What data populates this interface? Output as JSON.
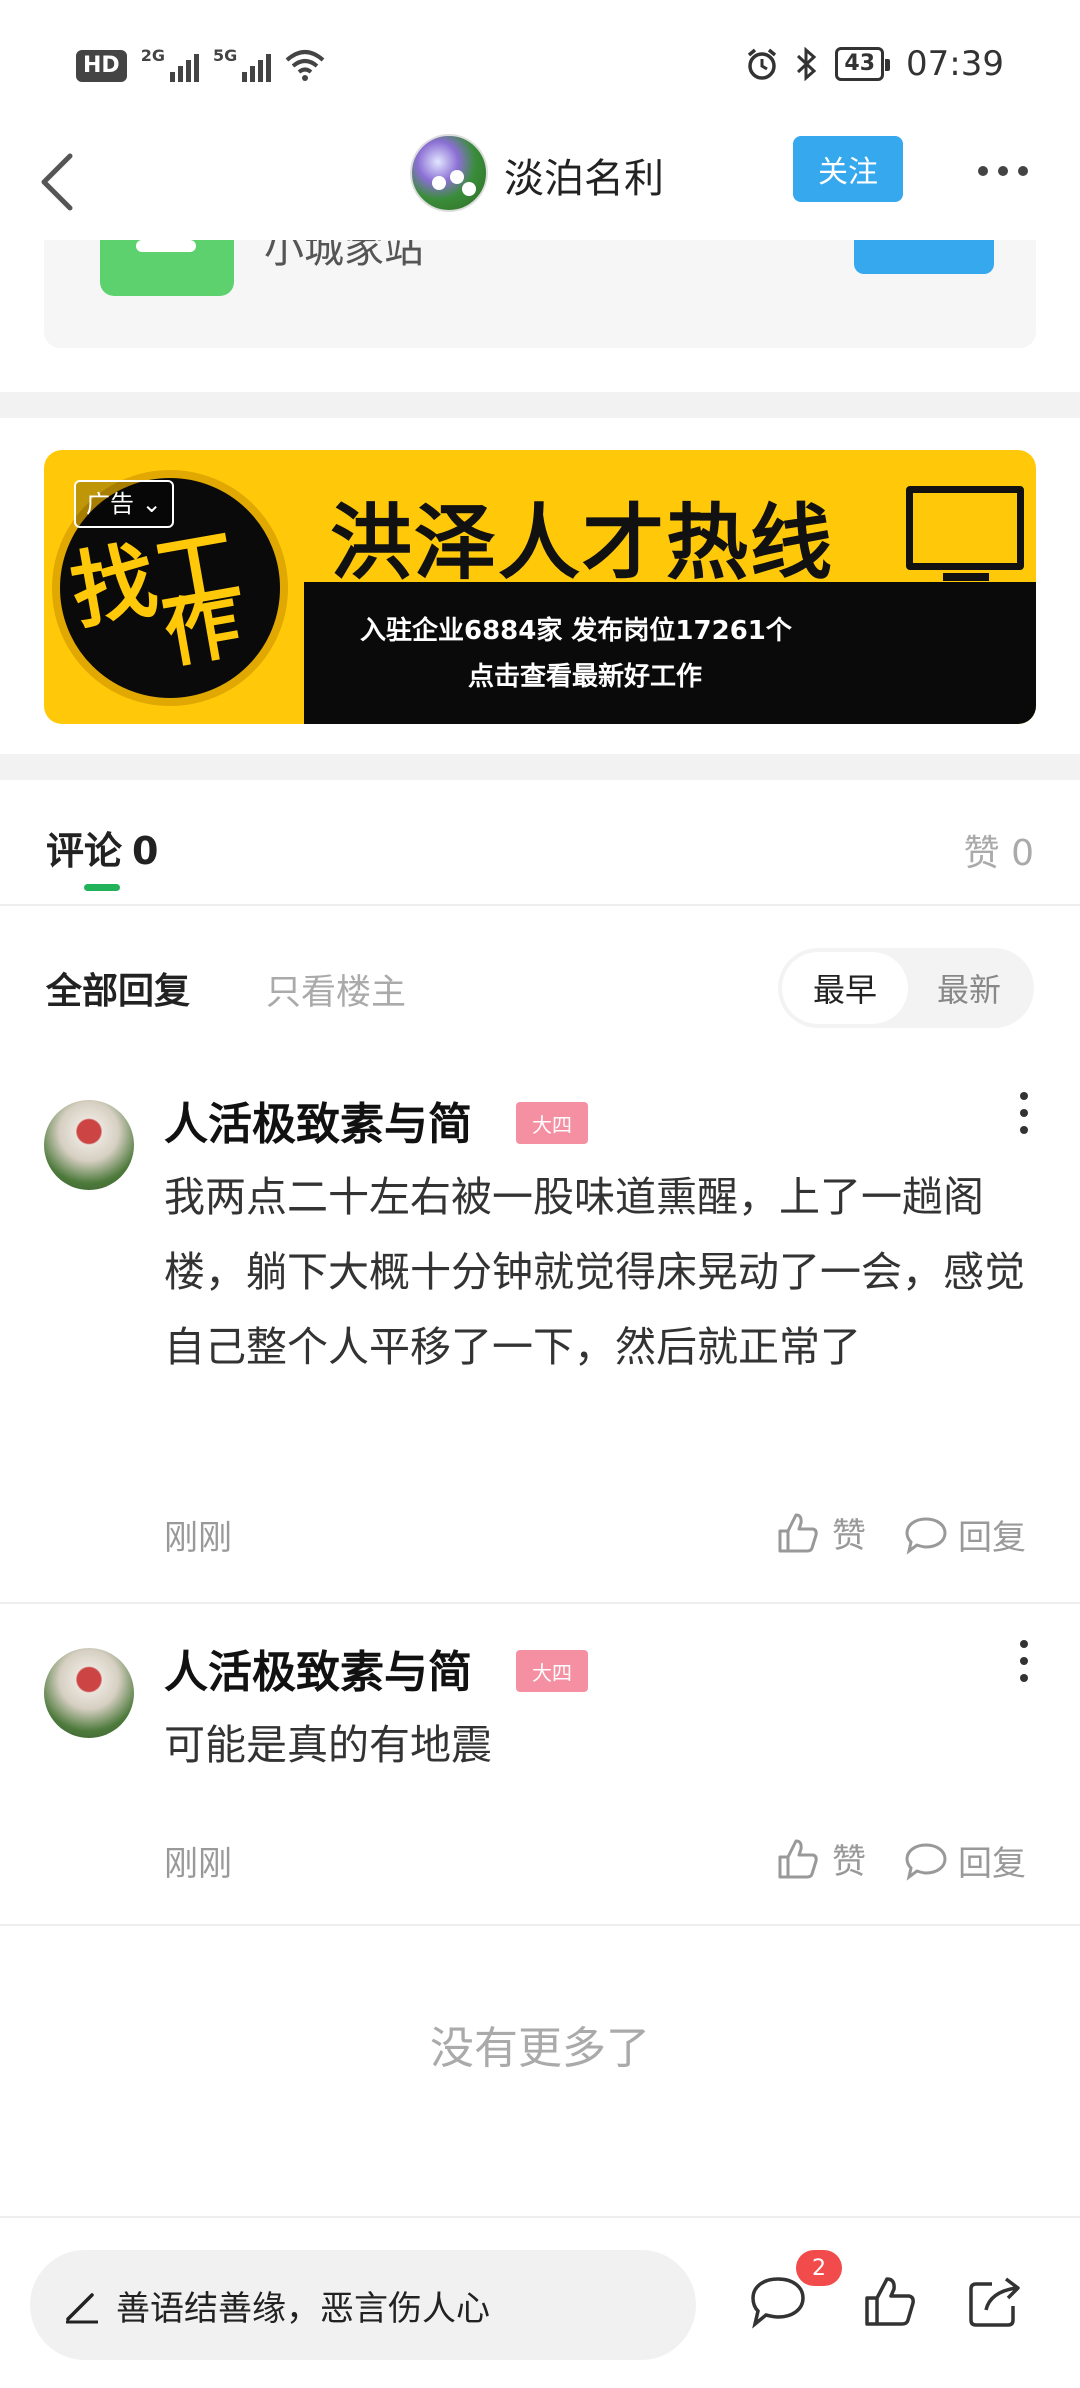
{
  "status_bar": {
    "network_label": "HD",
    "sim1_label": "2G",
    "sim2_label": "5G",
    "battery": "43",
    "time": "07:39"
  },
  "nav": {
    "title": "淡泊名利",
    "follow_label": "关注"
  },
  "peek_card": {
    "text": "小城家站"
  },
  "ad": {
    "badge": "广告 ⌄",
    "circle_text_1": "找工",
    "circle_text_2": "作",
    "headline": "洪泽人才热线",
    "line1": "入驻企业6884家  发布岗位17261个",
    "line2": "点击查看最新好工作"
  },
  "comments_header": {
    "comments_label": "评论",
    "comments_count": "0",
    "likes_label": "赞",
    "likes_count": "0"
  },
  "filter": {
    "all_label": "全部回复",
    "op_only_label": "只看楼主",
    "sort_earliest": "最早",
    "sort_newest": "最新"
  },
  "comments": [
    {
      "author": "人活极致素与简",
      "badge": "大四",
      "text": "我两点二十左右被一股味道熏醒，上了一趟阁楼，躺下大概十分钟就觉得床晃动了一会，感觉自己整个人平移了一下，然后就正常了",
      "time": "刚刚",
      "like_label": "赞",
      "reply_label": "回复"
    },
    {
      "author": "人活极致素与简",
      "badge": "大四",
      "text": "可能是真的有地震",
      "time": "刚刚",
      "like_label": "赞",
      "reply_label": "回复"
    }
  ],
  "no_more": "没有更多了",
  "bottom_bar": {
    "input_placeholder": "善语结善缘，恶言伤人心",
    "comment_badge": "2"
  },
  "colors": {
    "accent_blue": "#35a8ee",
    "accent_green": "#22b35a",
    "badge_pink": "#f58fa2",
    "ad_yellow": "#ffc90a",
    "notif_red": "#f24b4b"
  }
}
